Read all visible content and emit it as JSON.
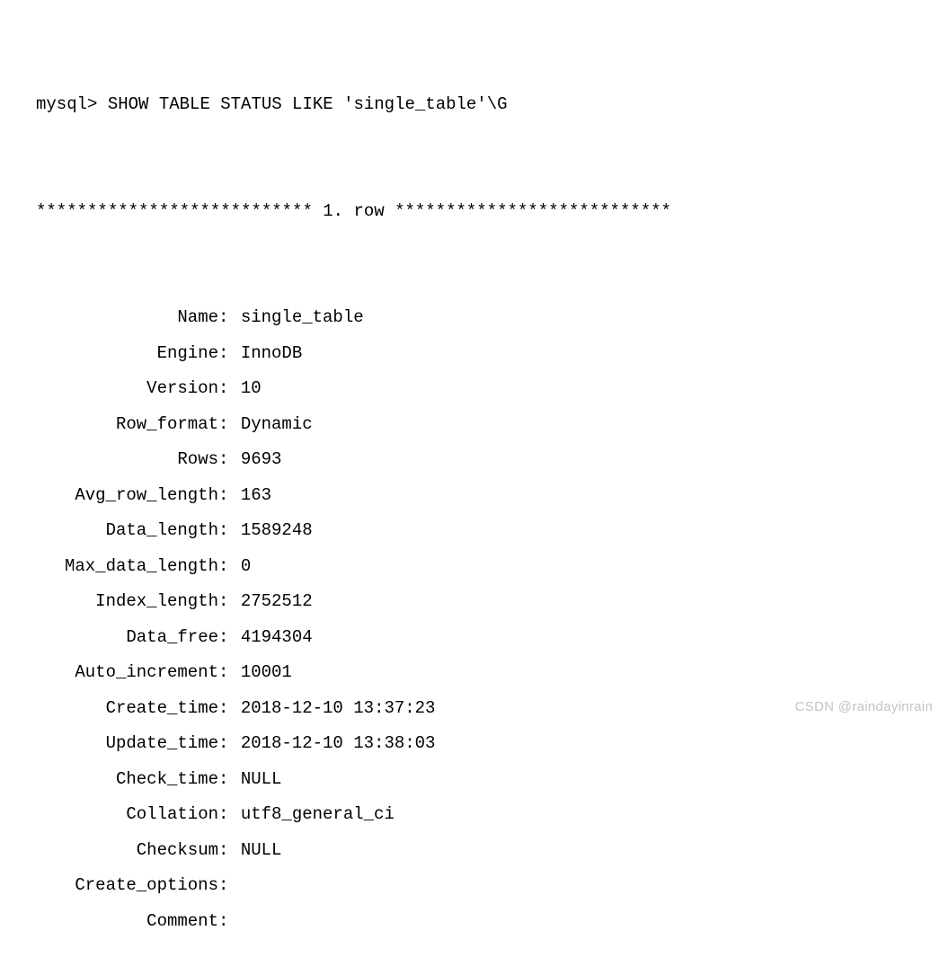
{
  "prompt": "mysql>",
  "command": "SHOW TABLE STATUS LIKE 'single_table'\\G",
  "separator": "*************************** 1. row ***************************",
  "fields": [
    {
      "label": "Name",
      "value": "single_table"
    },
    {
      "label": "Engine",
      "value": "InnoDB"
    },
    {
      "label": "Version",
      "value": "10"
    },
    {
      "label": "Row_format",
      "value": "Dynamic"
    },
    {
      "label": "Rows",
      "value": "9693"
    },
    {
      "label": "Avg_row_length",
      "value": "163"
    },
    {
      "label": "Data_length",
      "value": "1589248"
    },
    {
      "label": "Max_data_length",
      "value": "0"
    },
    {
      "label": "Index_length",
      "value": "2752512"
    },
    {
      "label": "Data_free",
      "value": "4194304"
    },
    {
      "label": "Auto_increment",
      "value": "10001"
    },
    {
      "label": "Create_time",
      "value": "2018-12-10 13:37:23"
    },
    {
      "label": "Update_time",
      "value": "2018-12-10 13:38:03"
    },
    {
      "label": "Check_time",
      "value": "NULL"
    },
    {
      "label": "Collation",
      "value": "utf8_general_ci"
    },
    {
      "label": "Checksum",
      "value": "NULL"
    },
    {
      "label": "Create_options",
      "value": ""
    },
    {
      "label": "Comment",
      "value": ""
    }
  ],
  "watermark": "CSDN @raindayinrain"
}
